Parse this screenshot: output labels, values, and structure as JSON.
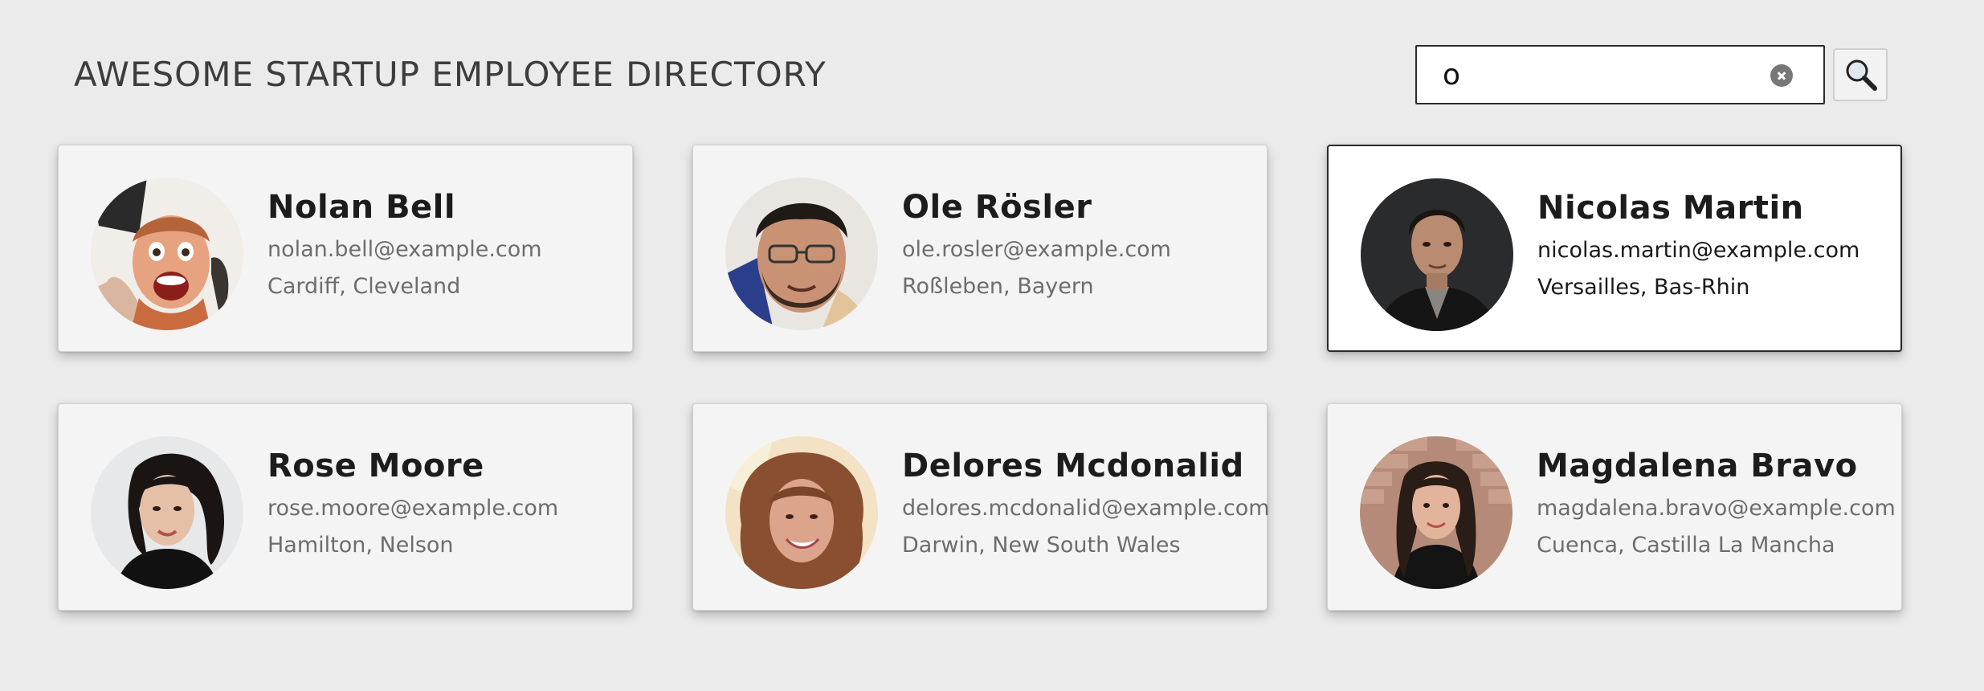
{
  "header": {
    "title": "AWESOME STARTUP EMPLOYEE DIRECTORY"
  },
  "search": {
    "value": "o",
    "clear_icon": "clear-circle-x-icon",
    "button_icon": "magnifying-glass-icon"
  },
  "colors": {
    "background": "#ebebeb",
    "card": "#f4f4f4",
    "card_active": "#ffffff",
    "text_primary": "#1c1c1c",
    "text_secondary": "#6d6d6d"
  },
  "employees": [
    {
      "name": "Nolan Bell",
      "email": "nolan.bell@example.com",
      "location": "Cardiff, Cleveland",
      "active": false
    },
    {
      "name": "Ole Rösler",
      "email": "ole.rosler@example.com",
      "location": "Roßleben, Bayern",
      "active": false
    },
    {
      "name": "Nicolas Martin",
      "email": "nicolas.martin@example.com",
      "location": "Versailles, Bas-Rhin",
      "active": true
    },
    {
      "name": "Rose Moore",
      "email": "rose.moore@example.com",
      "location": "Hamilton, Nelson",
      "active": false
    },
    {
      "name": "Delores Mcdonalid",
      "email": "delores.mcdonalid@example.com",
      "location": "Darwin, New South Wales",
      "active": false
    },
    {
      "name": "Magdalena Bravo",
      "email": "magdalena.bravo@example.com",
      "location": "Cuenca, Castilla La Mancha",
      "active": false
    }
  ]
}
